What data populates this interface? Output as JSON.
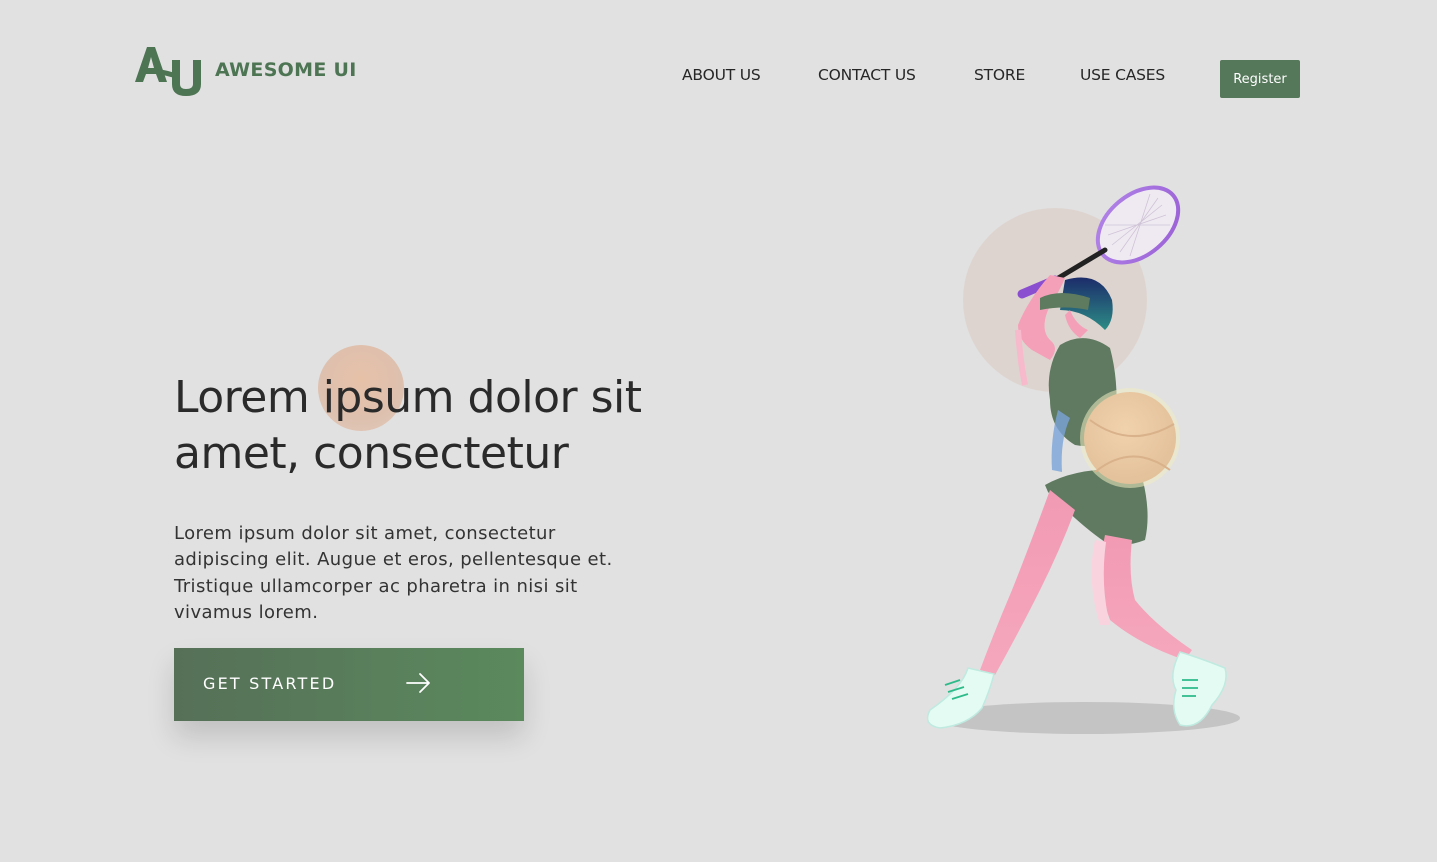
{
  "brand": {
    "logo_text": "AWESOME UI",
    "color": "#4d7453"
  },
  "nav": {
    "items": [
      "ABOUT US",
      "CONTACT US",
      "STORE",
      "USE CASES"
    ],
    "register_label": "Register"
  },
  "hero": {
    "title": "Lorem ipsum dolor sit amet, consectetur",
    "subtitle": "Lorem ipsum dolor sit amet, consectetur adipiscing elit. Augue et eros, pellentesque et. Tristique ullamcorper ac pharetra in nisi sit vivamus lorem.",
    "cta_label": "GET STARTED",
    "cta_icon": "arrow-right-icon"
  },
  "illustration": {
    "subject": "tennis-player-illustration"
  },
  "colors": {
    "background": "#e1e1e1",
    "accent_green": "#55775a",
    "text_dark": "#2a2a2a"
  }
}
